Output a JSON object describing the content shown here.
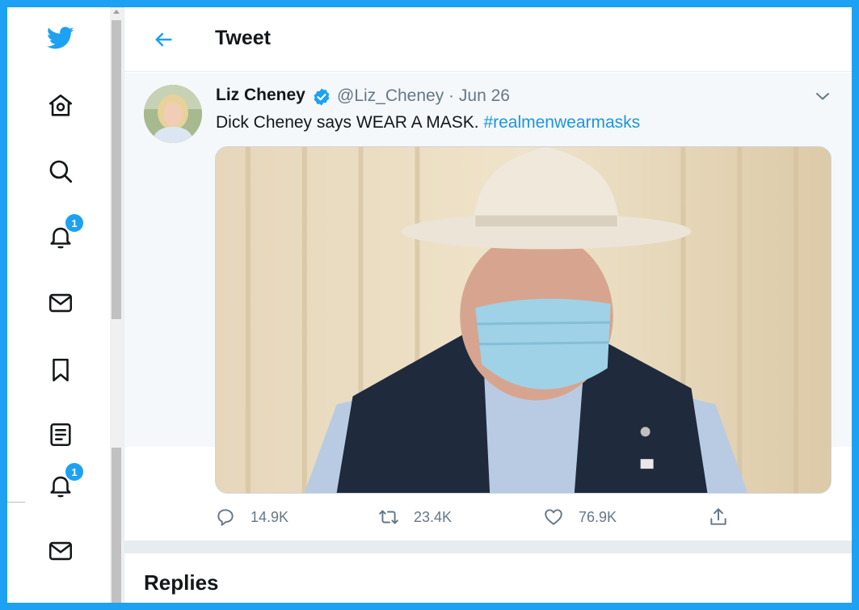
{
  "nav": {
    "items": [
      {
        "icon": "twitter-logo-icon"
      },
      {
        "icon": "home-icon"
      },
      {
        "icon": "search-icon"
      },
      {
        "icon": "bell-icon",
        "badge": "1"
      },
      {
        "icon": "mail-icon"
      },
      {
        "icon": "bookmark-icon"
      },
      {
        "icon": "list-icon"
      },
      {
        "icon": "bell-icon",
        "badge": "1"
      },
      {
        "icon": "mail-icon"
      }
    ]
  },
  "header": {
    "title": "Tweet"
  },
  "tweet": {
    "name": "Liz Cheney",
    "handle_date": "@Liz_Cheney · Jun 26",
    "text": "Dick Cheney says WEAR A MASK. ",
    "hashtag": "#realmenwearmasks",
    "reply_count": "14.9K",
    "retweet_count": "23.4K",
    "like_count": "76.9K"
  },
  "replies": {
    "title": "Replies"
  },
  "colors": {
    "accent": "#1da1f2",
    "text": "#14171a",
    "muted": "#657786",
    "link": "#1b95e0"
  }
}
